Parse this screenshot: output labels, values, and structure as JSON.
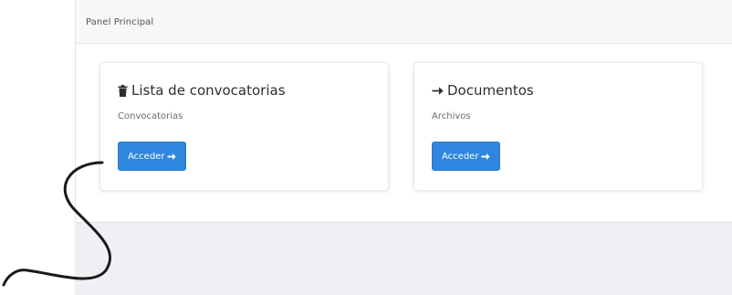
{
  "panel": {
    "header_title": "Panel Principal"
  },
  "cards": [
    {
      "icon": "trash-icon",
      "title": "Lista de convocatorias",
      "subtitle": "Convocatorias",
      "button_label": "Acceder"
    },
    {
      "icon": "arrow-right-icon",
      "title": "Documentos",
      "subtitle": "Archivos",
      "button_label": "Acceder"
    }
  ],
  "colors": {
    "accent": "#2e86de",
    "background": "#eef0f3",
    "header_bg": "#f7f7f8"
  }
}
